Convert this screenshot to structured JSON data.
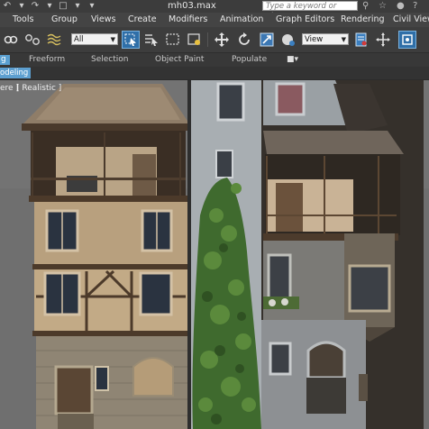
{
  "window": {
    "file_title": "mh03.max",
    "search_placeholder": "Type a keyword or phrase"
  },
  "menu": {
    "items": [
      "Tools",
      "Group",
      "Views",
      "Create",
      "Modifiers",
      "Animation",
      "Graph Editors",
      "Rendering",
      "Civil View"
    ]
  },
  "toolbar": {
    "selection_filter": "All",
    "reference_coord": "View"
  },
  "ribbon": {
    "tabs": [
      "g",
      "Freeform",
      "Selection",
      "Object Paint",
      "Populate"
    ],
    "sub_label": "odeling"
  },
  "viewport": {
    "label_left": "ere ]",
    "label_shading": "[ Realistic ]"
  },
  "colors": {
    "accent": "#5aa0d2",
    "menubar": "#444444",
    "toolbar": "#3d3d3d"
  }
}
